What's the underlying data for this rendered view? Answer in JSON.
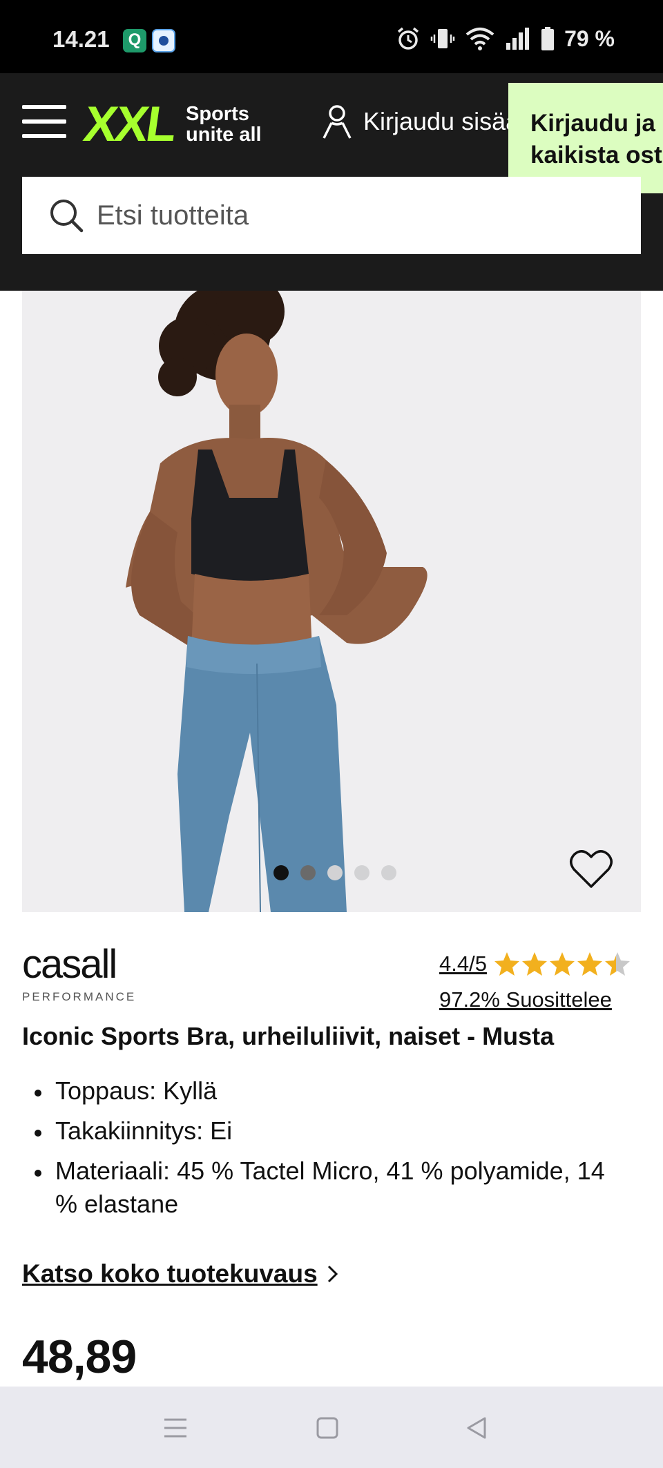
{
  "status_bar": {
    "time": "14.21",
    "battery": "79 %",
    "icons": [
      "app-q-icon",
      "app-weather-icon",
      "alarm-icon",
      "vibrate-icon",
      "wifi-icon",
      "signal-icon",
      "battery-icon"
    ]
  },
  "header": {
    "logo_main": "XXL",
    "logo_tag_line1": "Sports",
    "logo_tag_line2": "unite all",
    "login_label": "Kirjaudu sisään",
    "tooltip_line1": "Kirjaudu ja",
    "tooltip_line2": "kaikista ostoksista",
    "search_placeholder": "Etsi tuotteita",
    "brand_color": "#a6ff2e",
    "tooltip_color": "#dcfdc0"
  },
  "gallery": {
    "image_count": 5,
    "active_index": 0
  },
  "product": {
    "brand": "casall",
    "brand_sub": "PERFORMANCE",
    "rating": "4.4/5",
    "rating_value": 4.4,
    "rating_max": 5,
    "recommend": "97.2% Suosittelee",
    "title": "Iconic Sports Bra, urheiluliivit, naiset - Musta",
    "features": [
      "Toppaus: Kyllä",
      "Takakiinnitys: Ei",
      "Materiaali: 45 % Tactel Micro, 41 % polyamide, 14 % elastane"
    ],
    "more_link": "Katso koko tuotekuvaus",
    "price": "48,89",
    "star_color": "#f2b01e"
  }
}
